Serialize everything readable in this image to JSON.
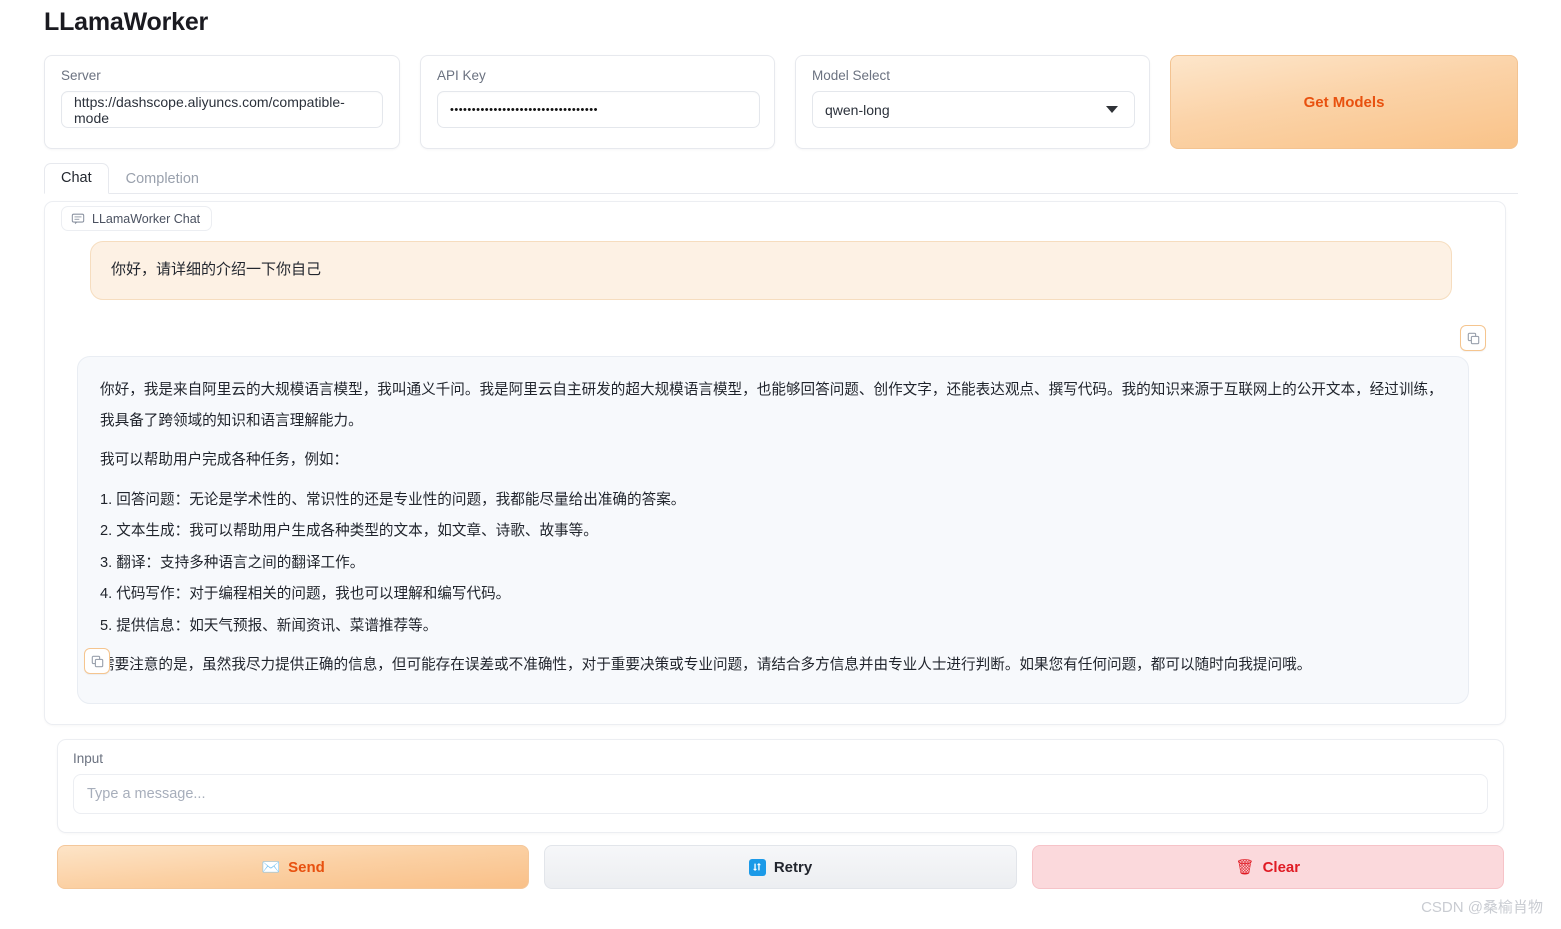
{
  "app": {
    "title": "LLamaWorker"
  },
  "config": {
    "server": {
      "label": "Server",
      "value": "https://dashscope.aliyuncs.com/compatible-mode"
    },
    "api_key": {
      "label": "API Key",
      "value": "••••••••••••••••••••••••••••••••••"
    },
    "model_select": {
      "label": "Model Select",
      "value": "qwen-long",
      "options": [
        "qwen-long"
      ]
    },
    "get_models_button": "Get Models"
  },
  "tabs": [
    {
      "label": "Chat",
      "active": true
    },
    {
      "label": "Completion",
      "active": false
    }
  ],
  "chat": {
    "tag_label": "LLamaWorker Chat",
    "tag_icon": "speech-bubble-icon",
    "user_message": "你好，请详细的介绍一下你自己",
    "assistant_message": {
      "intro": "你好，我是来自阿里云的大规模语言模型，我叫通义千问。我是阿里云自主研发的超大规模语言模型，也能够回答问题、创作文字，还能表达观点、撰写代码。我的知识来源于互联网上的公开文本，经过训练，我具备了跨领域的知识和语言理解能力。",
      "list_intro": "我可以帮助用户完成各种任务，例如：",
      "items": [
        "1. 回答问题：无论是学术性的、常识性的还是专业性的问题，我都能尽量给出准确的答案。",
        "2. 文本生成：我可以帮助用户生成各种类型的文本，如文章、诗歌、故事等。",
        "3. 翻译：支持多种语言之间的翻译工作。",
        "4. 代码写作：对于编程相关的问题，我也可以理解和编写代码。",
        "5. 提供信息：如天气预报、新闻资讯、菜谱推荐等。"
      ],
      "outro": "需要注意的是，虽然我尽力提供正确的信息，但可能存在误差或不准确性，对于重要决策或专业问题，请结合多方信息并由专业人士进行判断。如果您有任何问题，都可以随时向我提问哦。"
    },
    "copy_icon": "copy-icon"
  },
  "input": {
    "label": "Input",
    "value": "",
    "placeholder": "Type a message..."
  },
  "actions": [
    {
      "label": "Send",
      "icon": "envelope-icon",
      "emoji": "✉️"
    },
    {
      "label": "Retry",
      "icon": "refresh-icon",
      "emoji": ""
    },
    {
      "label": "Clear",
      "icon": "trash-icon",
      "emoji": "🗑"
    }
  ],
  "watermark": "CSDN @桑榆肖物",
  "colors": {
    "accent_orange": "#e8510f",
    "clear_red": "#e01b24",
    "retry_blue": "#1b9ae8",
    "user_bubble_bg": "#fdf1e4",
    "assistant_bubble_bg": "#f7f9fc"
  }
}
